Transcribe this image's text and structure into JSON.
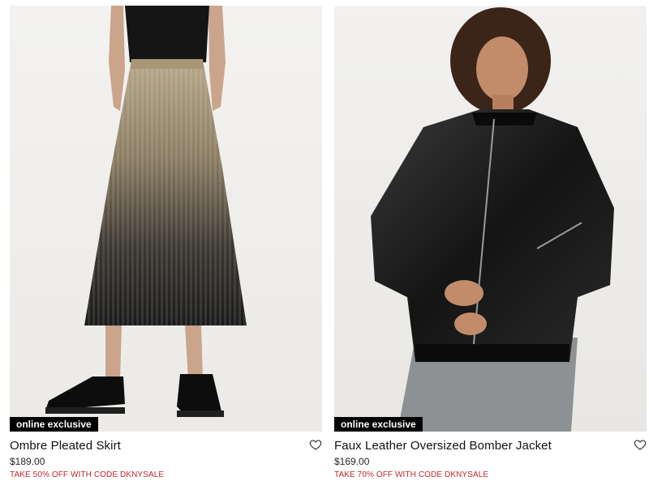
{
  "products": [
    {
      "badge": "online exclusive",
      "name": "Ombre Pleated Skirt",
      "price": "$189.00",
      "promo": "TAKE 50% OFF WITH CODE DKNYSALE",
      "wishlist_icon": "heart-outline-icon",
      "image_subject": "model-wearing-ombre-pleated-skirt"
    },
    {
      "badge": "online exclusive",
      "name": "Faux Leather Oversized Bomber Jacket",
      "price": "$169.00",
      "promo": "TAKE 70% OFF WITH CODE DKNYSALE",
      "wishlist_icon": "heart-outline-icon",
      "image_subject": "model-wearing-faux-leather-bomber-jacket"
    }
  ],
  "colors": {
    "badge_bg": "#000000",
    "badge_text": "#ffffff",
    "promo_text": "#c0272d",
    "photo_bg": "#f1efec"
  }
}
